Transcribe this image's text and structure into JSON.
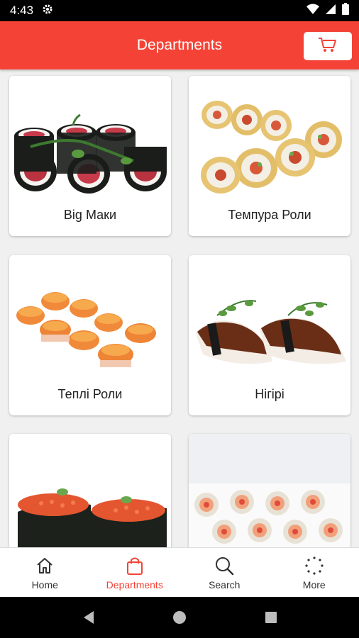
{
  "status_bar": {
    "time": "4:43"
  },
  "header": {
    "title": "Departments"
  },
  "categories": [
    {
      "label": "Big Маки"
    },
    {
      "label": "Темпура Роли"
    },
    {
      "label": "Теплі Роли"
    },
    {
      "label": "Нігірі"
    },
    {
      "label": ""
    },
    {
      "label": ""
    }
  ],
  "bottom_nav": {
    "items": [
      {
        "label": "Home",
        "icon": "home-icon"
      },
      {
        "label": "Departments",
        "icon": "bag-icon"
      },
      {
        "label": "Search",
        "icon": "search-icon"
      },
      {
        "label": "More",
        "icon": "more-icon"
      }
    ],
    "active_index": 1
  },
  "colors": {
    "accent": "#f44336",
    "background": "#f0f0f0"
  }
}
